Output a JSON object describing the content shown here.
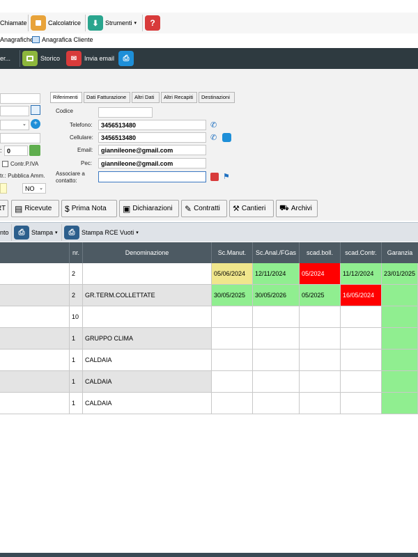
{
  "toolbar_top": {
    "chiamate": "Chiamate",
    "calcolatrice": "Calcolatrice",
    "strumenti": "Strumenti"
  },
  "menu_second": {
    "anagrafiche": "Anagrafiche",
    "anagrafica_cliente": "Anagrafica Cliente"
  },
  "toolbar_dark": {
    "truncated": "er...",
    "storico": "Storico",
    "invia_email": "Invia email"
  },
  "left_form": {
    "numero_value": "0",
    "contr_piva": "Contr.P.IVA",
    "pubblica_amm": "tr.: Pubblica Amm.",
    "pubblica_amm_value": "NO"
  },
  "tabs": [
    "Riferimenti",
    "Dati Fatturazione",
    "Altri Dati",
    "Altri Recapiti",
    "Destinazioni"
  ],
  "riferimenti": {
    "codice_label": "Codice",
    "codice_value": "",
    "telefono_label": "Telefono:",
    "telefono_value": "3456513480",
    "cellulare_label": "Cellulare:",
    "cellulare_value": "3456513480",
    "email_label": "Email:",
    "email_value": "giannileone@gmail.com",
    "pec_label": "Pec:",
    "pec_value": "giannileone@gmail.com",
    "associare_label_1": "Associare a",
    "associare_label_2": "contatto:",
    "associare_value": ""
  },
  "action_buttons": {
    "rt": "RT",
    "ricevute": "Ricevute",
    "prima_nota": "Prima Nota",
    "dichiarazioni": "Dichiarazioni",
    "contratti": "Contratti",
    "cantieri": "Cantieri",
    "archivi": "Archivi"
  },
  "grid_toolbar": {
    "truncated": "nto",
    "stampa": "Stampa",
    "stampa_rce": "Stampa RCE Vuoti"
  },
  "grid": {
    "headers": {
      "nr": "nr.",
      "denominazione": "Denominazione",
      "sc_manut": "Sc.Manut.",
      "sc_anal": "Sc.Anal./FGas",
      "scad_boll": "scad.boll.",
      "scad_contr": "scad.Contr.",
      "garanzia": "Garanzia"
    },
    "rows": [
      {
        "nr": "2",
        "denominazione": "",
        "sc_manut": "05/06/2024",
        "sc_anal": "12/11/2024",
        "scad_boll": "05/2024",
        "scad_contr": "11/12/2024",
        "garanzia": "23/01/2025"
      },
      {
        "nr": "2",
        "denominazione": "GR.TERM.COLLETTATE",
        "sc_manut": "30/05/2025",
        "sc_anal": "30/05/2026",
        "scad_boll": "05/2025",
        "scad_contr": "16/05/2024",
        "garanzia": ""
      },
      {
        "nr": "10",
        "denominazione": "",
        "sc_manut": "",
        "sc_anal": "",
        "scad_boll": "",
        "scad_contr": "",
        "garanzia": ""
      },
      {
        "nr": "1",
        "denominazione": "GRUPPO CLIMA",
        "sc_manut": "",
        "sc_anal": "",
        "scad_boll": "",
        "scad_contr": "",
        "garanzia": ""
      },
      {
        "nr": "1",
        "denominazione": "CALDAIA",
        "sc_manut": "",
        "sc_anal": "",
        "scad_boll": "",
        "scad_contr": "",
        "garanzia": ""
      },
      {
        "nr": "1",
        "denominazione": "CALDAIA",
        "sc_manut": "",
        "sc_anal": "",
        "scad_boll": "",
        "scad_contr": "",
        "garanzia": ""
      },
      {
        "nr": "1",
        "denominazione": "CALDAIA",
        "sc_manut": "",
        "sc_anal": "",
        "scad_boll": "",
        "scad_contr": "",
        "garanzia": ""
      }
    ]
  },
  "colors": {
    "yellow": "#f0e68c",
    "green": "#90ee90",
    "red": "#ff0000",
    "header_bg": "#4d5a63",
    "dark_toolbar": "#2e3a40"
  }
}
